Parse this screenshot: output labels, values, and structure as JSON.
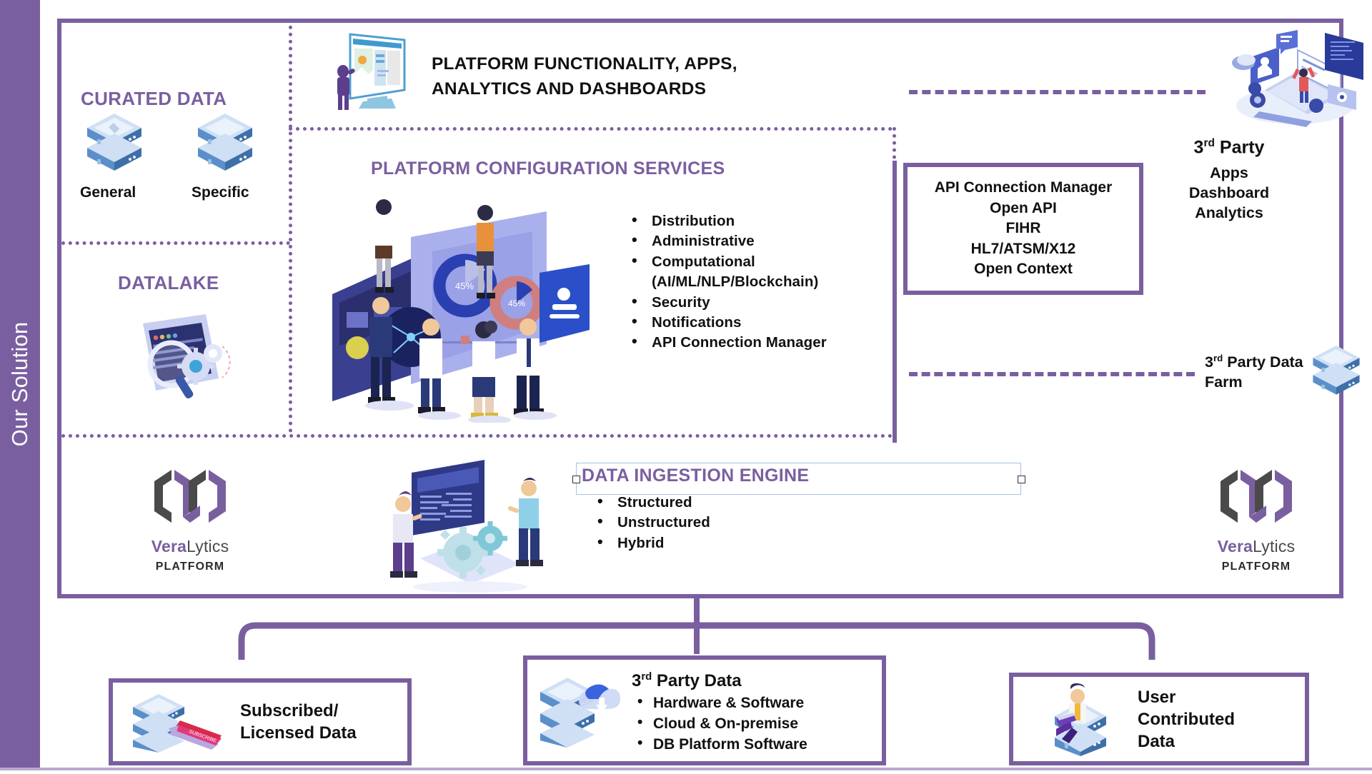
{
  "sidebar": {
    "label": "Our Solution"
  },
  "left_column": {
    "curated": {
      "title": "CURATED DATA",
      "items": [
        {
          "label": "General",
          "icon": "server-stack-icon"
        },
        {
          "label": "Specific",
          "icon": "server-stack-icon"
        }
      ]
    },
    "datalake": {
      "title": "DATALAKE",
      "icon": "datalake-search-gear-icon"
    }
  },
  "banner": {
    "title": "PLATFORM FUNCTIONALITY, APPS, ANALYTICS AND DASHBOARDS",
    "icon": "desktop-dashboard-illustration"
  },
  "services": {
    "title": "PLATFORM CONFIGURATION SERVICES",
    "icon": "team-analytics-illustration",
    "bullets": [
      "Distribution",
      "Administrative",
      "Computational",
      "(AI/ML/NLP/Blockchain)",
      "Security",
      "Notifications",
      "API Connection Manager"
    ]
  },
  "api_box": {
    "lines": [
      "API Connection Manager",
      "Open API",
      "FIHR",
      "HL7/ATSM/X12",
      "Open Context"
    ]
  },
  "third_party": {
    "title_prefix": "3",
    "title_sup": "rd",
    "title_suffix": " Party",
    "icon": "laptop-devices-illustration",
    "sub_lines": [
      "Apps",
      "Dashboard",
      "Analytics"
    ]
  },
  "data_farm": {
    "prefix": "3",
    "sup": "rd",
    "suffix": " Party Data Farm",
    "icon": "server-stack-icon"
  },
  "ingestion": {
    "title": "DATA INGESTION ENGINE",
    "icon": "gears-data-illustration",
    "bullets": [
      "Structured",
      "Unstructured",
      "Hybrid"
    ],
    "selected": true
  },
  "logos": {
    "left": {
      "name_a": "Vera",
      "name_b": "Lytics",
      "sub": "PLATFORM",
      "icon": "veralytics-hexagon-logo"
    },
    "right": {
      "name_a": "Vera",
      "name_b": "Lytics",
      "sub": "PLATFORM",
      "icon": "veralytics-hexagon-logo"
    }
  },
  "sources": {
    "subscribed": {
      "title_line1": "Subscribed/",
      "title_line2": "Licensed Data",
      "icon": "subscribe-server-icon"
    },
    "third_party_data": {
      "prefix": "3",
      "sup": "rd",
      "suffix": " Party Data",
      "icon": "cloud-server-icon",
      "bullets": [
        "Hardware & Software",
        "Cloud & On-premise",
        "DB Platform Software"
      ]
    },
    "user_contributed": {
      "title_line1": "User",
      "title_line2": "Contributed",
      "title_line3": "Data",
      "icon": "person-on-server-icon"
    }
  },
  "colors": {
    "brand_purple": "#7a5fa0",
    "ribbon": "#7a5fa0",
    "selection_blue": "#a8c0ea",
    "logo_gray": "#4a4a4a"
  }
}
